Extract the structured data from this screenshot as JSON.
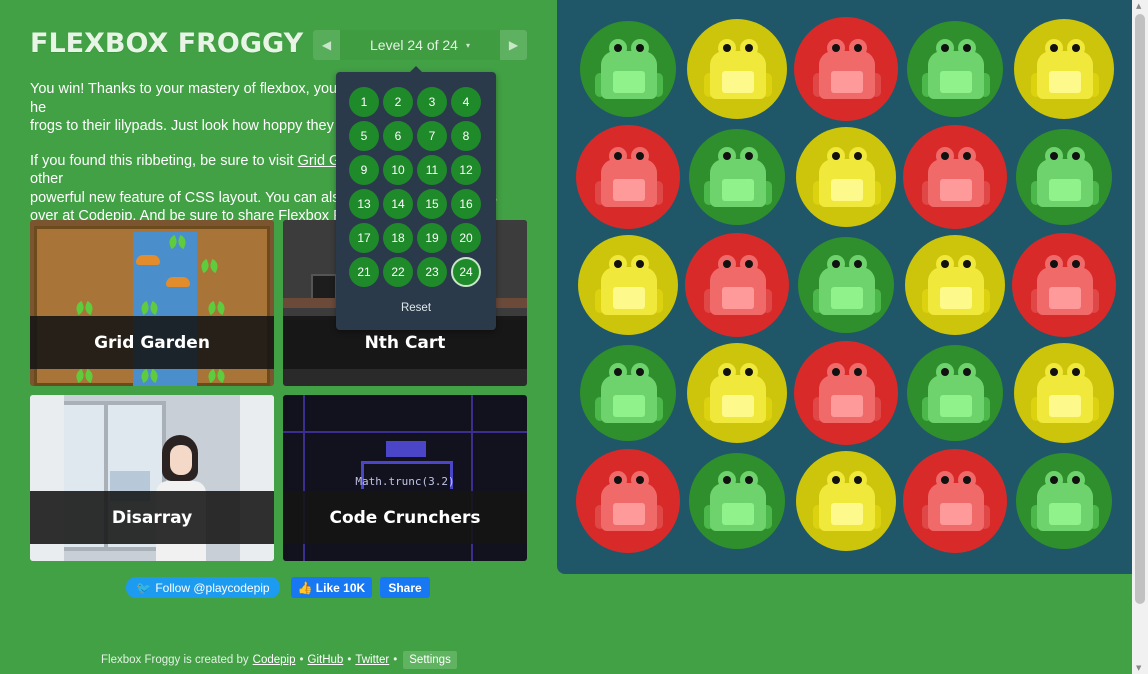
{
  "title": "FLEXBOX FROGGY",
  "level_nav": {
    "prev_icon": "triangle-left-icon",
    "next_icon": "triangle-right-icon",
    "indicator": "Level 24 of 24",
    "caret": "▾"
  },
  "instructions": {
    "p1_visible": "You win! Thanks to your mastery of flexbox, you",
    "p1_tail": "he",
    "p1_line2": "frogs to their lilypads. Just look how hoppy they",
    "p2_start": "If you found this ribbeting, be sure to visit",
    "p2_link1": "Grid G",
    "p2_end1": "other",
    "p2_line2": "powerful new feature of CSS layout. You can also",
    "p2_tail2": "s",
    "p2_line3_start": "over at",
    "p2_link2": "Codepip",
    "p2_line3_end": ". And be sure to share Flexbox Fr"
  },
  "games": [
    {
      "label": "Grid Garden"
    },
    {
      "label": "Nth Cart"
    },
    {
      "label": "Disarray"
    },
    {
      "label": "Code Crunchers",
      "code": "Math.trunc(3.2)"
    }
  ],
  "social": {
    "twitter": "Follow @playcodepip",
    "like": "Like 10K",
    "share": "Share"
  },
  "footer": {
    "prefix": "Flexbox Froggy is created by",
    "codepip": "Codepip",
    "github": "GitHub",
    "twitter": "Twitter",
    "sep": "•",
    "settings": "Settings"
  },
  "level_dropdown": {
    "levels": [
      "1",
      "2",
      "3",
      "4",
      "5",
      "6",
      "7",
      "8",
      "9",
      "10",
      "11",
      "12",
      "13",
      "14",
      "15",
      "16",
      "17",
      "18",
      "19",
      "20",
      "21",
      "22",
      "23",
      "24"
    ],
    "current": "24",
    "reset": "Reset"
  },
  "board": {
    "colors": {
      "green": {
        "pad": "#2f8f2c",
        "frog": "#6fd36d",
        "dark": "#4cb84b",
        "belly": "#8ff28b"
      },
      "yellow": {
        "pad": "#cdc40c",
        "frog": "#f0e83a",
        "dark": "#dcd20f",
        "belly": "#fdf98a"
      },
      "red": {
        "pad": "#d92a2a",
        "frog": "#f06a6a",
        "dark": "#e04848",
        "belly": "#ff9a9a"
      }
    },
    "rows": [
      [
        "green",
        "yellow",
        "red",
        "green",
        "yellow"
      ],
      [
        "red",
        "green",
        "yellow",
        "red",
        "green"
      ],
      [
        "yellow",
        "red",
        "green",
        "yellow",
        "red"
      ],
      [
        "green",
        "yellow",
        "red",
        "green",
        "yellow"
      ],
      [
        "red",
        "green",
        "yellow",
        "red",
        "green"
      ]
    ]
  },
  "accent": {
    "background": "#42a045",
    "board": "#1f5768",
    "dropdown": "#2b3a4a"
  }
}
